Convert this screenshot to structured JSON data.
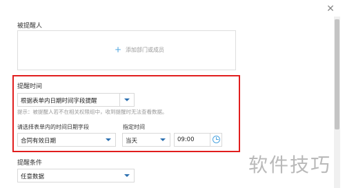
{
  "header": {
    "close_icon": "close-icon"
  },
  "reminded": {
    "label": "被提醒人",
    "add_label": "添加部门或成员",
    "add_icon": "plus-icon"
  },
  "remind_time": {
    "label": "提醒时间",
    "mode_value": "根据表单内日期时间字段提醒",
    "hint": "提示：被提醒人若不在相关权限组中，收到提醒时无法查看数据。",
    "field_label": "请选择表单内的时间日期字段",
    "field_value": "合同有效日期",
    "specify_label": "指定时间",
    "day_value": "当天",
    "time_value": "09:00"
  },
  "condition": {
    "label": "提醒条件",
    "value": "任意数据"
  },
  "watermark": "软件技巧",
  "colors": {
    "accent": "#2a6fb0",
    "highlight": "#e11d1d",
    "plus": "#4aa3df"
  }
}
